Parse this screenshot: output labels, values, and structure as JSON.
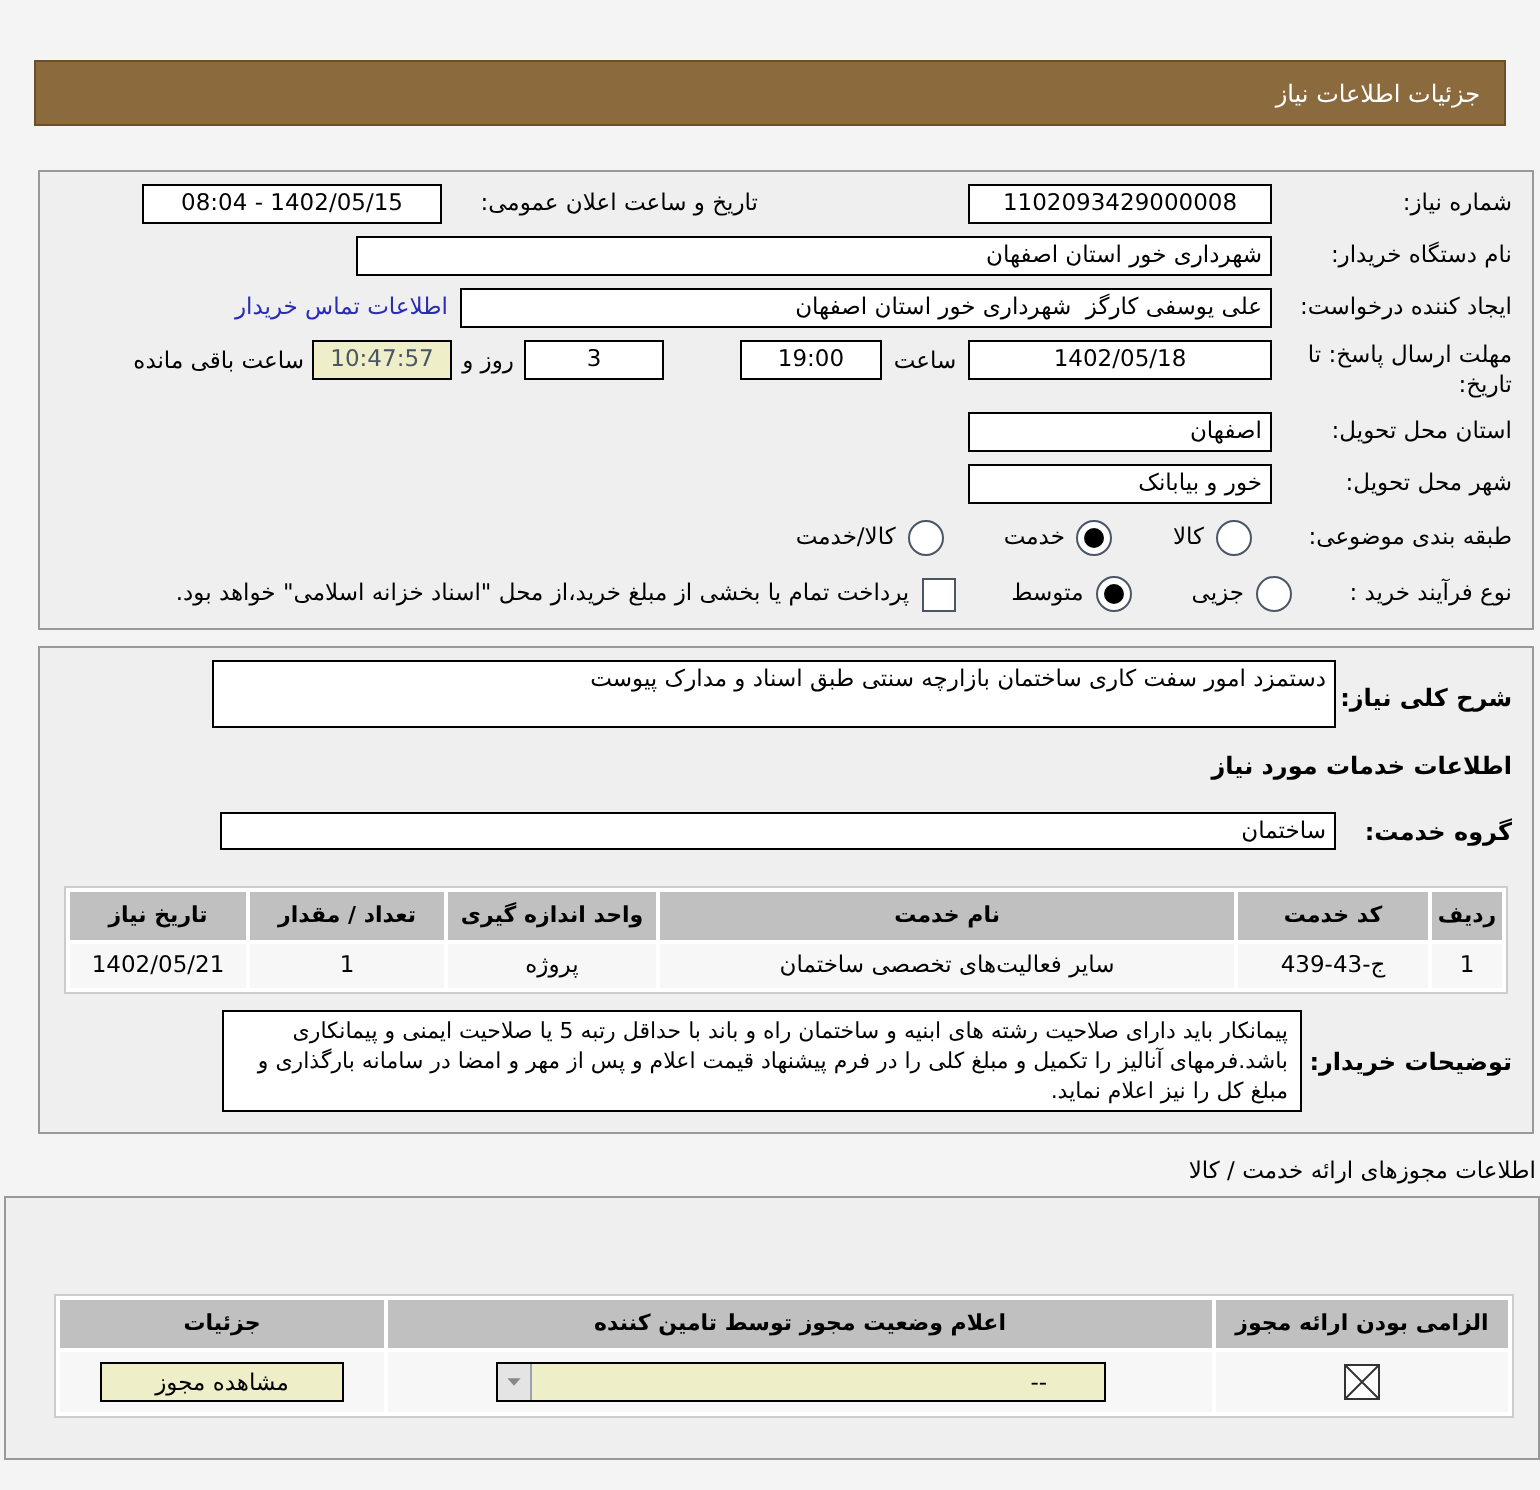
{
  "header": {
    "title": "جزئیات اطلاعات نیاز"
  },
  "need_number": {
    "label": "شماره نیاز:",
    "value": "1102093429000008"
  },
  "announce": {
    "label": "تاریخ و ساعت اعلان عمومی:",
    "value": "1402/05/15 - 08:04"
  },
  "buyer": {
    "label": "نام دستگاه خریدار:",
    "value": "شهرداری خور استان اصفهان"
  },
  "requester": {
    "label": "ایجاد کننده درخواست:",
    "value": "علی یوسفی کارگز  شهرداری خور استان اصفهان",
    "link": "اطلاعات تماس خریدار"
  },
  "deadline": {
    "label": "مهلت ارسال پاسخ: تا تاریخ:",
    "date": "1402/05/18",
    "time_label": "ساعت",
    "time": "19:00",
    "days": "3",
    "days_label": "روز و",
    "remaining": "10:47:57",
    "remaining_label": "ساعت باقی مانده"
  },
  "province": {
    "label": "استان محل تحویل:",
    "value": "اصفهان"
  },
  "city": {
    "label": "شهر محل تحویل:",
    "value": "خور و بیابانک"
  },
  "category": {
    "label": "طبقه بندی موضوعی:",
    "options": [
      {
        "label": "کالا",
        "selected": false
      },
      {
        "label": "خدمت",
        "selected": true
      },
      {
        "label": "کالا/خدمت",
        "selected": false
      }
    ]
  },
  "process": {
    "label": "نوع فرآیند خرید :",
    "options": [
      {
        "label": "جزیی",
        "selected": false
      },
      {
        "label": "متوسط",
        "selected": true
      }
    ],
    "payment": {
      "label": "پرداخت تمام یا بخشی از مبلغ خرید،از محل \"اسناد خزانه اسلامی\" خواهد بود.",
      "checked": false
    }
  },
  "description": {
    "label": "شرح کلی نیاز:",
    "value": "دستمزد امور سفت کاری ساختمان بازارچه سنتی طبق اسناد و مدارک پیوست"
  },
  "services_heading": "اطلاعات خدمات مورد نیاز",
  "service_group": {
    "label": "گروه خدمت:",
    "value": "ساختمان"
  },
  "services_table": {
    "columns": [
      "ردیف",
      "کد خدمت",
      "نام خدمت",
      "واحد اندازه گیری",
      "تعداد / مقدار",
      "تاریخ نیاز"
    ],
    "rows": [
      [
        "1",
        "ج-43-439",
        "سایر فعالیت‌های تخصصی ساختمان",
        "پروژه",
        "1",
        "1402/05/21"
      ]
    ]
  },
  "buyer_notes": {
    "label": "توضیحات خریدار:",
    "value": "پیمانکار باید دارای صلاحیت رشته های ابنیه و ساختمان راه و باند با حداقل رتبه 5 یا صلاحیت ایمنی و پیمانکاری باشد.فرمهای آنالیز را تکمیل و مبلغ کلی را در فرم پیشنهاد قیمت اعلام و پس از مهر و امضا در سامانه بارگذاری و مبلغ کل را نیز اعلام نماید."
  },
  "permits_heading": "اطلاعات مجوزهای ارائه خدمت / کالا",
  "permits_table": {
    "columns": [
      "الزامی بودن ارائه مجوز",
      "اعلام وضعیت مجوز توسط تامین کننده",
      "جزئیات"
    ],
    "rows": [
      {
        "required": true,
        "status": "--",
        "button": "مشاهده مجوز"
      }
    ]
  }
}
